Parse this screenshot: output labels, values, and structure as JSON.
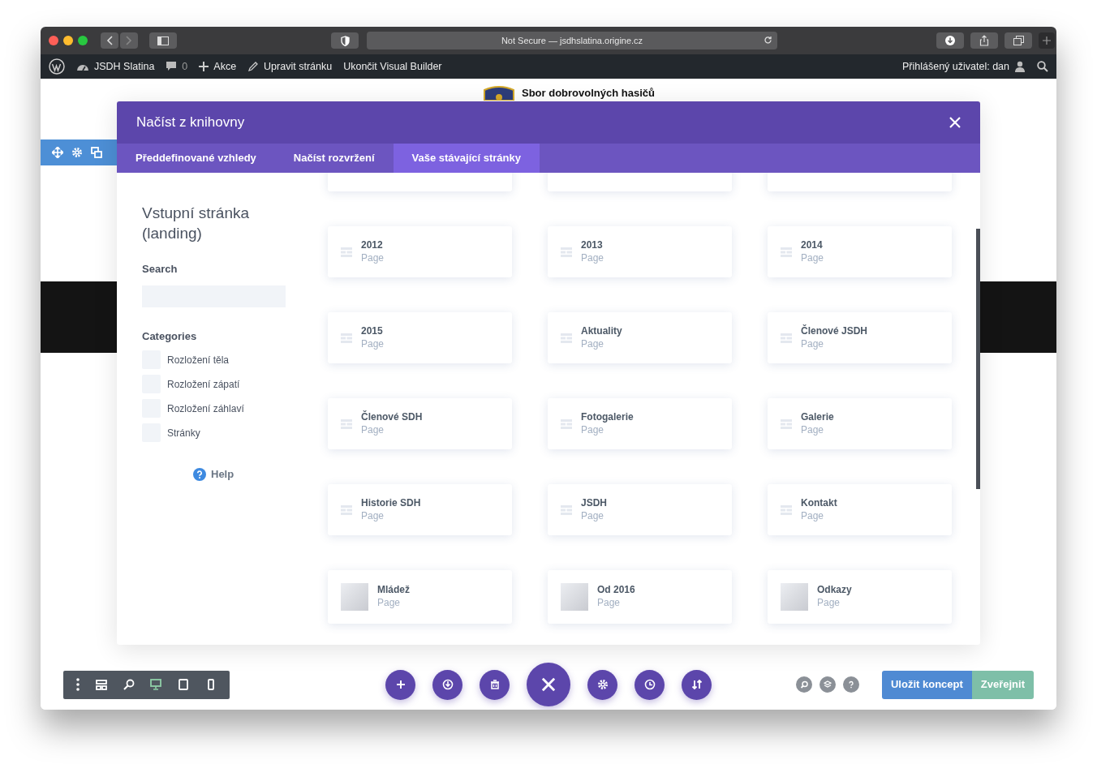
{
  "browser": {
    "address": "Not Secure — jsdhslatina.origine.cz"
  },
  "admin_bar": {
    "site": "JSDH Slatina",
    "comments": "0",
    "new": "Akce",
    "edit": "Upravit stránku",
    "exit": "Ukončit Visual Builder",
    "user": "Přihlášený uživatel: dan"
  },
  "site_header": {
    "title": "Sbor dobrovolných hasičů"
  },
  "modal": {
    "title": "Načíst z knihovny",
    "tabs": [
      {
        "label": "Předdefinované vzhledy",
        "selected": false
      },
      {
        "label": "Načíst rozvržení",
        "selected": false
      },
      {
        "label": "Vaše stávající stránky",
        "selected": true
      }
    ],
    "sidebar": {
      "heading": "Vstupní stránka (landing)",
      "search_label": "Search",
      "categories_label": "Categories",
      "categories": [
        {
          "label": "Rozložení těla",
          "checked": false
        },
        {
          "label": "Rozložení zápatí",
          "checked": false
        },
        {
          "label": "Rozložení záhlaví",
          "checked": false
        },
        {
          "label": "Stránky",
          "checked": false
        }
      ],
      "help": "Help"
    },
    "items": [
      {
        "title": "2012",
        "subtitle": "Page",
        "kind": "layout"
      },
      {
        "title": "2013",
        "subtitle": "Page",
        "kind": "layout"
      },
      {
        "title": "2014",
        "subtitle": "Page",
        "kind": "layout"
      },
      {
        "title": "2015",
        "subtitle": "Page",
        "kind": "layout"
      },
      {
        "title": "Aktuality",
        "subtitle": "Page",
        "kind": "layout"
      },
      {
        "title": "Členové JSDH",
        "subtitle": "Page",
        "kind": "layout"
      },
      {
        "title": "Členové SDH",
        "subtitle": "Page",
        "kind": "layout"
      },
      {
        "title": "Fotogalerie",
        "subtitle": "Page",
        "kind": "layout"
      },
      {
        "title": "Galerie",
        "subtitle": "Page",
        "kind": "layout"
      },
      {
        "title": "Historie SDH",
        "subtitle": "Page",
        "kind": "layout"
      },
      {
        "title": "JSDH",
        "subtitle": "Page",
        "kind": "layout"
      },
      {
        "title": "Kontakt",
        "subtitle": "Page",
        "kind": "layout"
      },
      {
        "title": "Mládež",
        "subtitle": "Page",
        "kind": "thumbnail"
      },
      {
        "title": "Od 2016",
        "subtitle": "Page",
        "kind": "thumbnail"
      },
      {
        "title": "Odkazy",
        "subtitle": "Page",
        "kind": "thumbnail"
      }
    ]
  },
  "bottom_bar": {
    "view_modes": [
      {
        "kind": "desktop",
        "selected": true
      },
      {
        "kind": "tablet",
        "selected": false
      },
      {
        "kind": "phone",
        "selected": false
      }
    ],
    "save": "Uložit koncept",
    "publish": "Zveřejnit"
  }
}
